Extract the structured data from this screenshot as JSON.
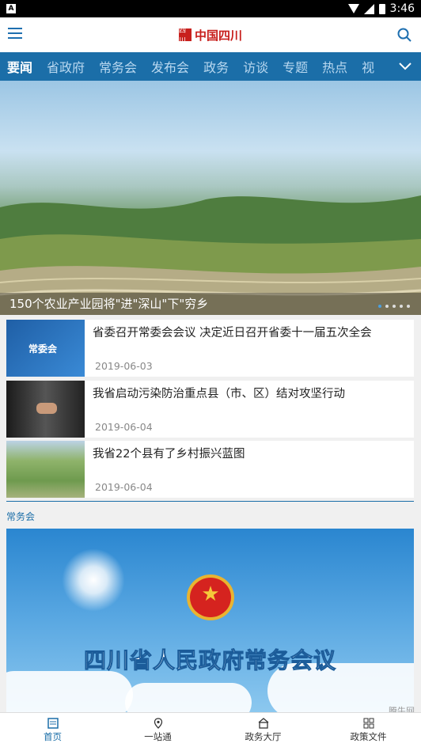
{
  "status_bar": {
    "left_badge": "A",
    "time": "3:46"
  },
  "app_bar": {
    "title": "中国四川",
    "seal_text": "四川"
  },
  "tabs": [
    {
      "label": "要闻",
      "active": true
    },
    {
      "label": "省政府",
      "active": false
    },
    {
      "label": "常务会",
      "active": false
    },
    {
      "label": "发布会",
      "active": false
    },
    {
      "label": "政务",
      "active": false
    },
    {
      "label": "访谈",
      "active": false
    },
    {
      "label": "专题",
      "active": false
    },
    {
      "label": "热点",
      "active": false
    },
    {
      "label": "视",
      "active": false
    }
  ],
  "hero": {
    "caption": "150个农业产业园将\"进\"深山\"下\"穷乡",
    "slides": 5,
    "current_slide": 1
  },
  "news": [
    {
      "headline": "省委召开常委会会议 决定近日召开省委十一届五次全会",
      "date": "2019-06-03",
      "thumb_label": "常委会"
    },
    {
      "headline": "我省启动污染防治重点县（市、区）结对攻坚行动",
      "date": "2019-06-04"
    },
    {
      "headline": "我省22个县有了乡村振兴蓝图",
      "date": "2019-06-04"
    }
  ],
  "section": {
    "title": "常务会"
  },
  "banner": {
    "title": "四川省人民政府常务会议"
  },
  "bottom_nav": [
    {
      "label": "首页",
      "active": true
    },
    {
      "label": "一站通",
      "active": false
    },
    {
      "label": "政务大厅",
      "active": false
    },
    {
      "label": "政策文件",
      "active": false
    }
  ],
  "watermark": "腾牛网",
  "colors": {
    "primary": "#1b6ea8",
    "brand_red": "#c8201d"
  }
}
